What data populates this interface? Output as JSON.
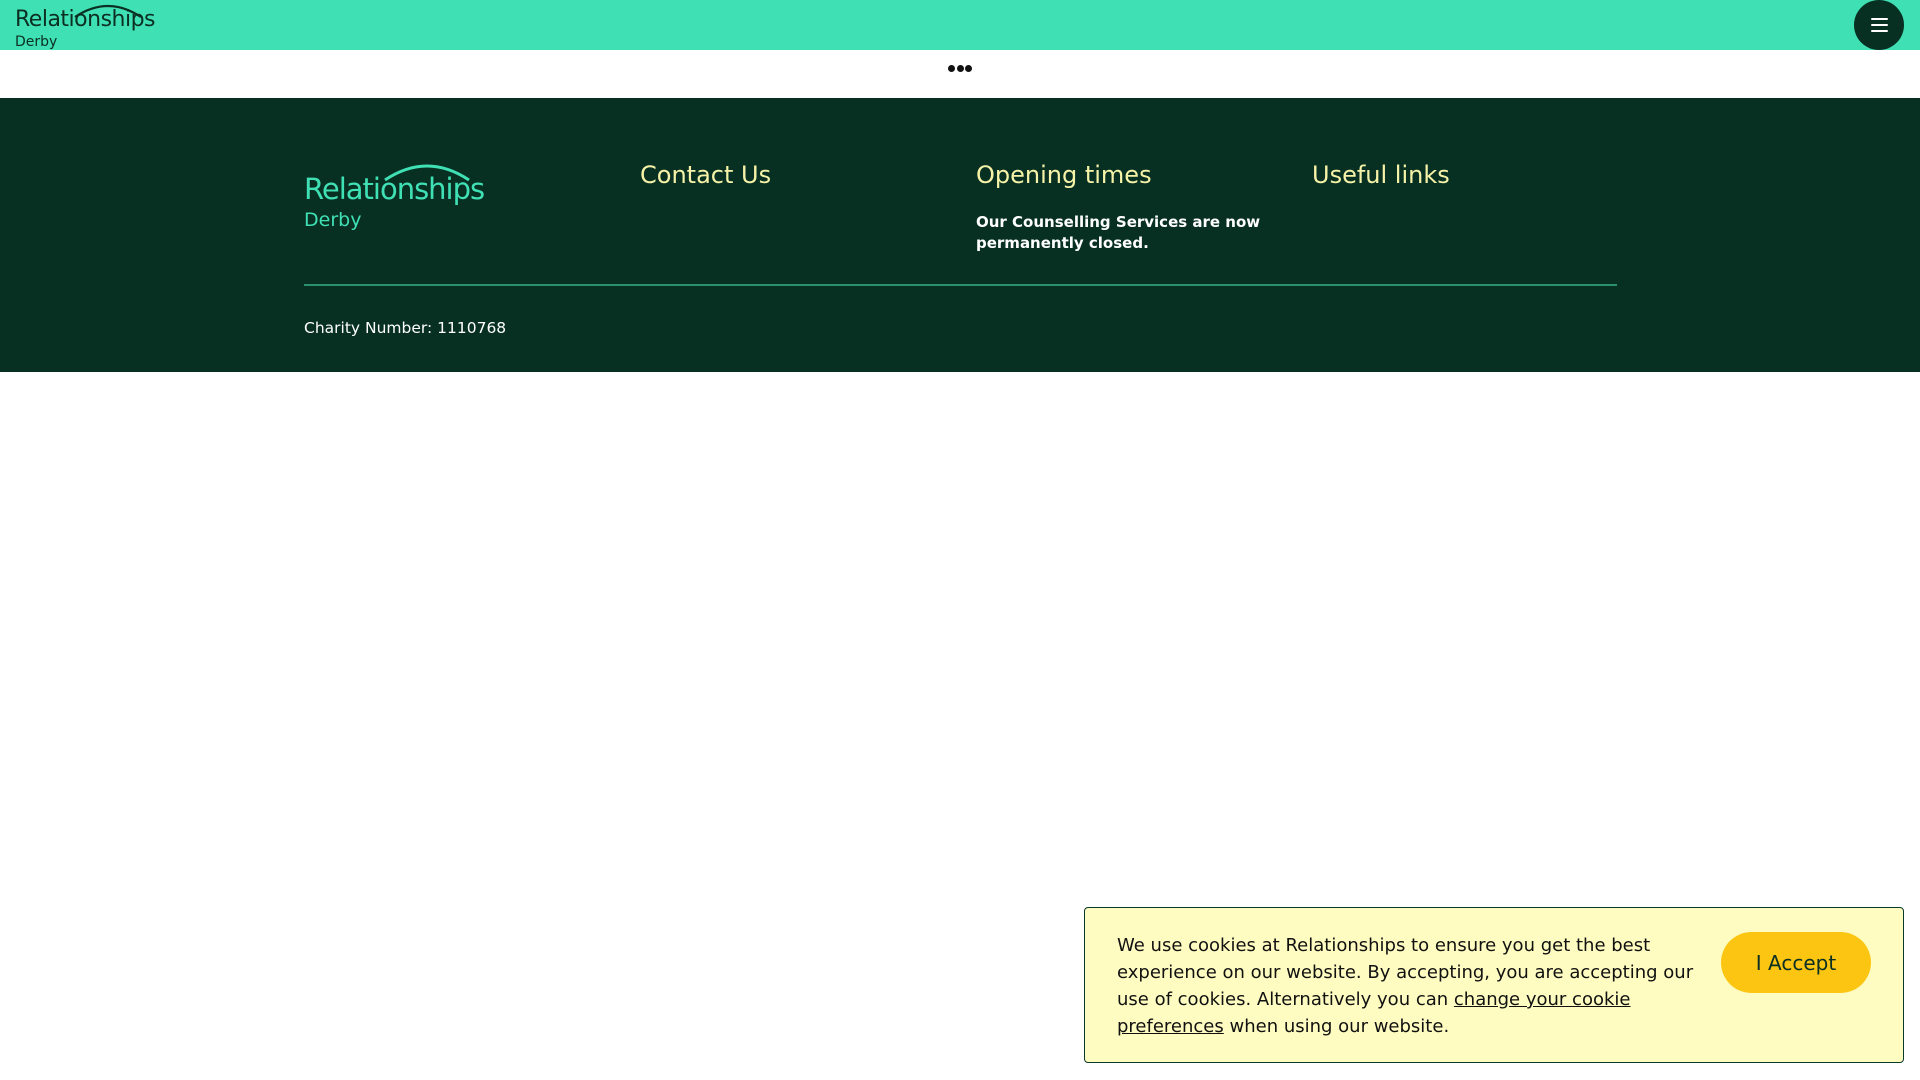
{
  "header": {
    "logo_word": "Relationships",
    "logo_sub": "Derby",
    "menu_icon": "hamburger-menu-icon",
    "brand_color": "#40e0b5"
  },
  "loader": {
    "icon": "loading-dots-icon"
  },
  "footer": {
    "background_color": "#073022",
    "logo_word": "Relationships",
    "logo_sub": "Derby",
    "contact_heading": "Contact Us",
    "opening_heading": "Opening times",
    "opening_text": "Our Counselling Services are now permanently closed.",
    "useful_links_heading": "Useful links",
    "charity_number": "Charity Number: 1110768",
    "heading_color": "#f6f3a8"
  },
  "cookie_banner": {
    "text_before_link": "We use cookies at Relationships to ensure you get the best experience on our website. By accepting, you are accepting our use of cookies. Alternatively you can ",
    "link_text": "change your cookie preferences",
    "text_after_link": " when using our website.",
    "accept_label": "I Accept",
    "background_color": "#fefcc0",
    "button_color": "#fcc512"
  }
}
